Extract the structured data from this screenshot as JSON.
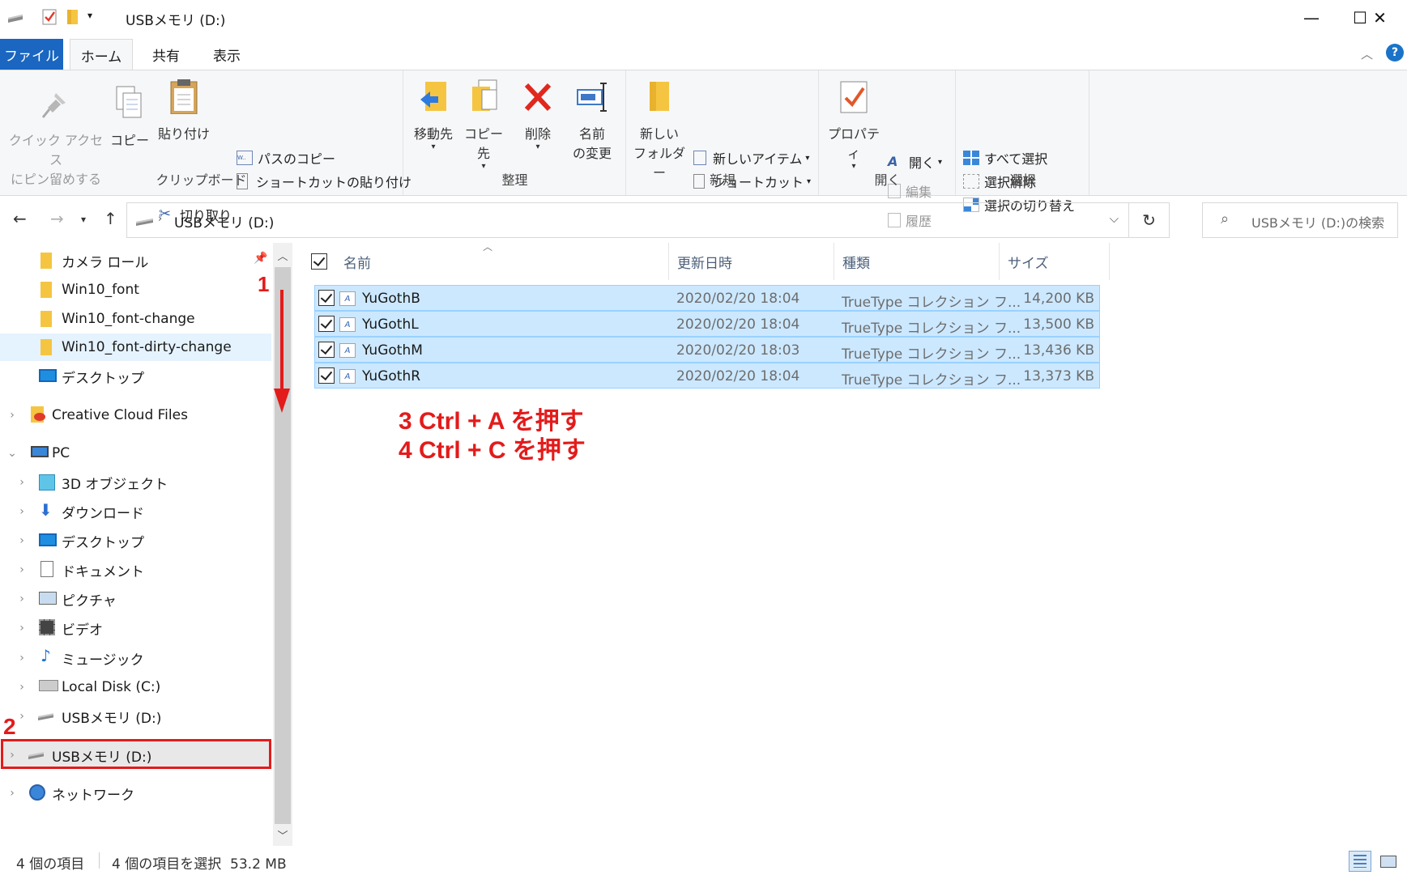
{
  "window": {
    "title": "USBメモリ (D:)",
    "controls": {
      "minimize": "—",
      "maximize": "☐",
      "close": "✕"
    }
  },
  "ribbon_tabs": {
    "file": "ファイル",
    "home": "ホーム",
    "share": "共有",
    "view": "表示",
    "help": "?"
  },
  "ribbon": {
    "clipboard": {
      "label": "クリップボード",
      "pin_line1": "クイック アクセス",
      "pin_line2": "にピン留めする",
      "copy": "コピー",
      "paste": "貼り付け",
      "copy_path": "パスのコピー",
      "paste_shortcut": "ショートカットの貼り付け",
      "cut": "切り取り"
    },
    "organize": {
      "label": "整理",
      "move_to": "移動先",
      "copy_to": "コピー先",
      "delete": "削除",
      "rename_line1": "名前",
      "rename_line2": "の変更"
    },
    "new": {
      "label": "新規",
      "new_folder_line1": "新しい",
      "new_folder_line2": "フォルダー",
      "new_item": "新しいアイテム",
      "easy_access": "ショートカット"
    },
    "open": {
      "label": "開く",
      "properties": "プロパティ",
      "open": "開く",
      "edit": "編集",
      "history": "履歴"
    },
    "select": {
      "label": "選択",
      "select_all": "すべて選択",
      "select_none": "選択解除",
      "invert": "選択の切り替え"
    }
  },
  "addressbar": {
    "path": "USBメモリ (D:)",
    "search_placeholder": "USBメモリ (D:)の検索"
  },
  "sidebar": {
    "items": [
      {
        "label": "カメラ ロール"
      },
      {
        "label": "Win10_font"
      },
      {
        "label": "Win10_font-change"
      },
      {
        "label": "Win10_font-dirty-change"
      },
      {
        "label": "デスクトップ"
      },
      {
        "label": "Creative Cloud Files"
      },
      {
        "label": "PC"
      },
      {
        "label": "3D オブジェクト"
      },
      {
        "label": "ダウンロード"
      },
      {
        "label": "デスクトップ"
      },
      {
        "label": "ドキュメント"
      },
      {
        "label": "ピクチャ"
      },
      {
        "label": "ビデオ"
      },
      {
        "label": "ミュージック"
      },
      {
        "label": "Local Disk (C:)"
      },
      {
        "label": "USBメモリ (D:)"
      },
      {
        "label": "USBメモリ (D:)"
      },
      {
        "label": "ネットワーク"
      }
    ]
  },
  "filelist": {
    "columns": {
      "name": "名前",
      "modified": "更新日時",
      "type": "種類",
      "size": "サイズ"
    },
    "rows": [
      {
        "name": "YuGothB",
        "modified": "2020/02/20 18:04",
        "type": "TrueType コレクション フ...",
        "size": "14,200 KB"
      },
      {
        "name": "YuGothL",
        "modified": "2020/02/20 18:04",
        "type": "TrueType コレクション フ...",
        "size": "13,500 KB"
      },
      {
        "name": "YuGothM",
        "modified": "2020/02/20 18:03",
        "type": "TrueType コレクション フ...",
        "size": "13,436 KB"
      },
      {
        "name": "YuGothR",
        "modified": "2020/02/20 18:04",
        "type": "TrueType コレクション フ...",
        "size": "13,373 KB"
      }
    ]
  },
  "annotations": {
    "step1": "1",
    "step2": "2",
    "step3": "3 Ctrl + A を押す",
    "step4": "4 Ctrl + C を押す",
    "color": "#e31b1b"
  },
  "statusbar": {
    "count": "4 個の項目",
    "selected": "4 個の項目を選択  53.2 MB"
  },
  "colors": {
    "accent": "#1a66c0",
    "selection": "#cce8ff",
    "selection_border": "#99d1ff"
  }
}
